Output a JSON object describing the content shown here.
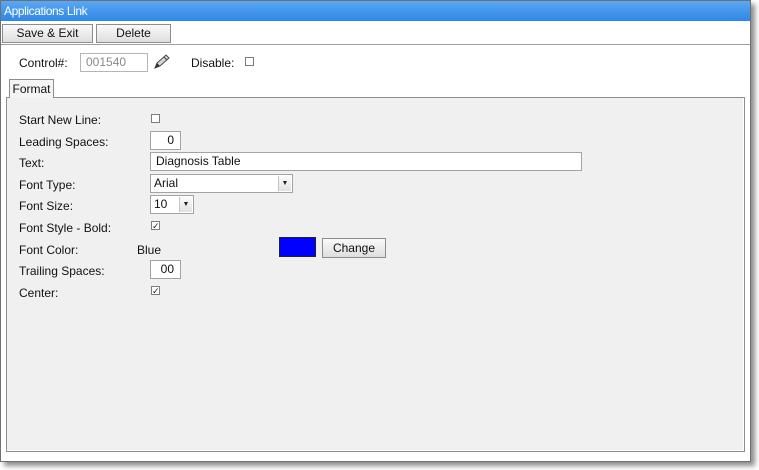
{
  "window": {
    "title": "Applications Link"
  },
  "toolbar": {
    "save_exit": "Save & Exit",
    "delete": "Delete"
  },
  "header": {
    "control_label": "Control#:",
    "control_value": "001540",
    "edit_icon": "pencil-icon",
    "disable_label": "Disable:",
    "disable_checked": false
  },
  "tabs": [
    {
      "label": "Format",
      "active": true
    }
  ],
  "form": {
    "start_new_line": {
      "label": "Start New Line:",
      "checked": false
    },
    "leading_spaces": {
      "label": "Leading Spaces:",
      "value": "0"
    },
    "text": {
      "label": "Text:",
      "value": "Diagnosis Table"
    },
    "font_type": {
      "label": "Font Type:",
      "value": "Arial"
    },
    "font_size": {
      "label": "Font Size:",
      "value": "10"
    },
    "font_bold": {
      "label": "Font Style - Bold:",
      "checked": true,
      "mark": "✓"
    },
    "font_color": {
      "label": "Font Color:",
      "value": "Blue",
      "swatch": "#0000ff",
      "change_label": "Change"
    },
    "trailing_spaces": {
      "label": "Trailing Spaces:",
      "value": "00"
    },
    "center": {
      "label": "Center:",
      "checked": true,
      "mark": "✓"
    }
  },
  "colors": {
    "titlebar": "#3a8fe8",
    "panel": "#f0f0f0"
  }
}
